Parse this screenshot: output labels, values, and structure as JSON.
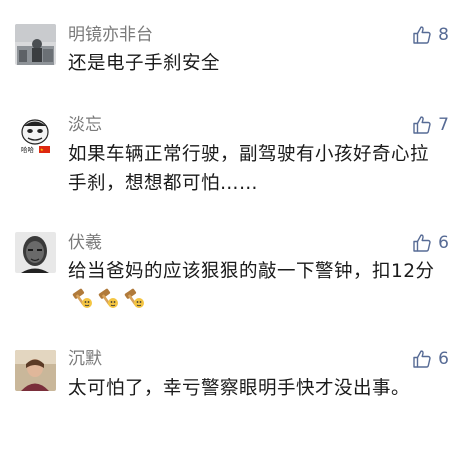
{
  "comments": [
    {
      "user": "明镜亦非台",
      "likes": "8",
      "text": "还是电子手刹安全"
    },
    {
      "user": "淡忘",
      "likes": "7",
      "avatar_caption": "哈哈",
      "text": "如果车辆正常行驶，副驾驶有小孩好奇心拉手刹，想想都可怕……"
    },
    {
      "user": "伏羲",
      "likes": "6",
      "text": "给当爸妈的应该狠狠的敲一下警钟，扣12分",
      "emoji": [
        "hammer-emoji",
        "hammer-emoji",
        "hammer-emoji"
      ]
    },
    {
      "user": "沉默",
      "likes": "6",
      "text": "太可怕了，幸亏警察眼明手快才没出事。"
    }
  ],
  "colors": {
    "name": "#7a7a7a",
    "like": "#576b95",
    "text": "#1a1a1a"
  }
}
